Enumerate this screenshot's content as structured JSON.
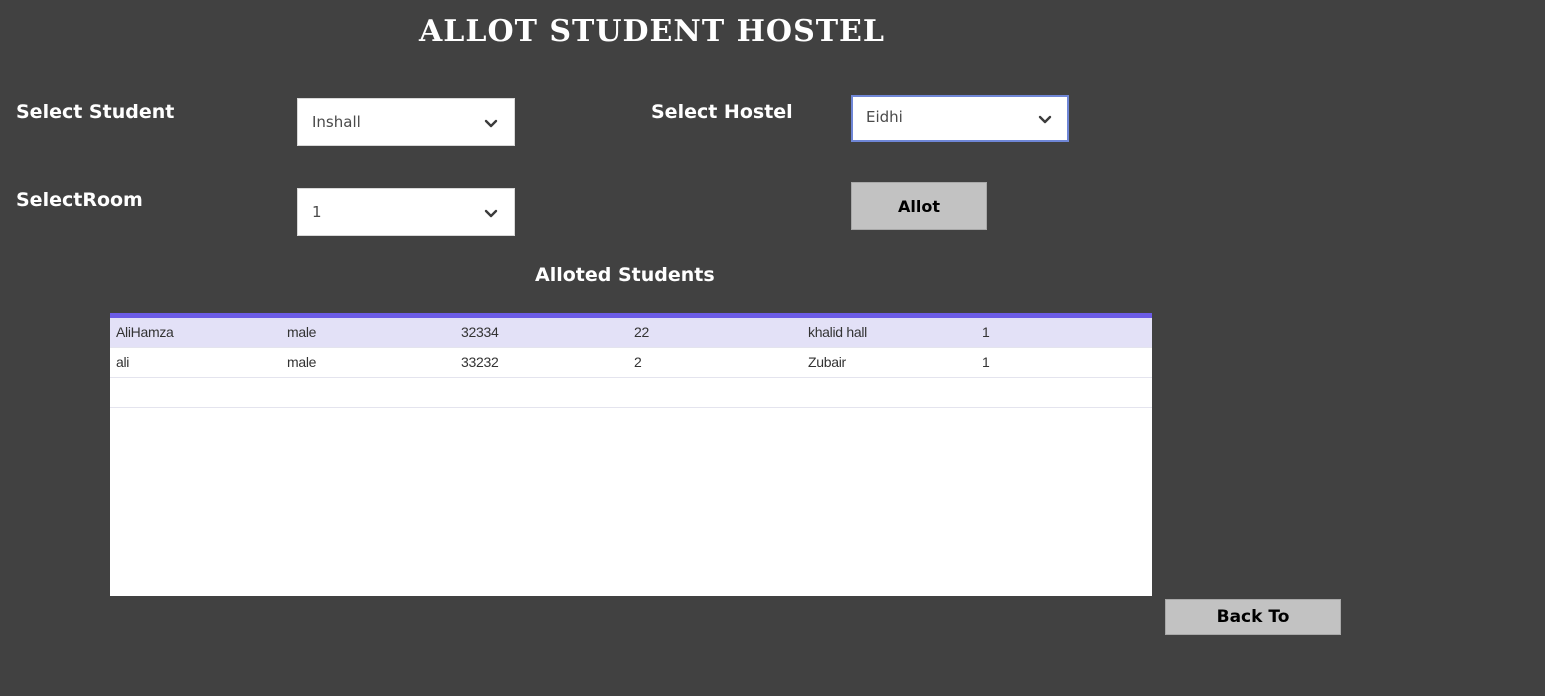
{
  "page_title": "ALLOT STUDENT HOSTEL",
  "form": {
    "student_label": "Select Student",
    "student_value": "Inshall",
    "hostel_label": "Select Hostel",
    "hostel_value": "Eidhi",
    "room_label": "SelectRoom",
    "room_value": "1",
    "allot_button": "Allot"
  },
  "alloted_section": {
    "heading": "Alloted Students",
    "rows": [
      [
        "AliHamza",
        "male",
        "32334",
        "22",
        "khalid hall",
        "1"
      ],
      [
        "ali",
        "male",
        "33232",
        "2",
        "Zubair",
        "1"
      ]
    ]
  },
  "back_button": "Back To",
  "colors": {
    "background": "#414141",
    "grid_header_accent": "#6c5ce7",
    "selected_row": "#e3e1f7",
    "button": "#c2c2c2",
    "focused_border": "#6f86d6"
  },
  "icons": {
    "dropdown": "chevron-down-icon"
  }
}
